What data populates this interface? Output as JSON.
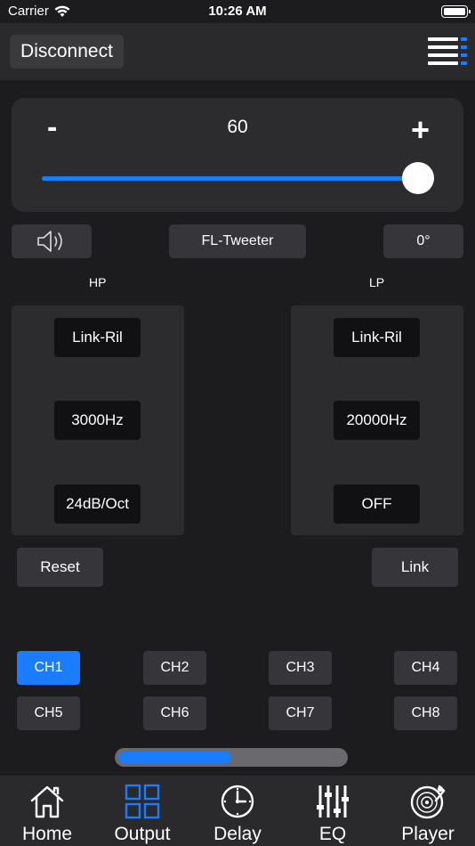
{
  "status": {
    "carrier": "Carrier",
    "time": "10:26 AM"
  },
  "nav": {
    "disconnect_label": "Disconnect"
  },
  "volume": {
    "minus": "-",
    "value": "60",
    "plus": "+",
    "level_percent": 100
  },
  "channel_info": {
    "name": "FL-Tweeter",
    "phase": "0°"
  },
  "hp": {
    "label": "HP",
    "type": "Link-Ril",
    "frequency": "3000Hz",
    "slope": "24dB/Oct"
  },
  "lp": {
    "label": "LP",
    "type": "Link-Ril",
    "frequency": "20000Hz",
    "slope": "OFF"
  },
  "actions": {
    "reset": "Reset",
    "link": "Link"
  },
  "channels": [
    "CH1",
    "CH2",
    "CH3",
    "CH4",
    "CH5",
    "CH6",
    "CH7",
    "CH8"
  ],
  "active_channel": "CH1",
  "progress": {
    "fraction": 0.5
  },
  "tabs": [
    {
      "label": "Home",
      "icon": "home-icon"
    },
    {
      "label": "Output",
      "icon": "grid-icon"
    },
    {
      "label": "Delay",
      "icon": "clock-icon"
    },
    {
      "label": "EQ",
      "icon": "equalizer-icon"
    },
    {
      "label": "Player",
      "icon": "vinyl-icon"
    }
  ],
  "active_tab": "Output",
  "colors": {
    "accent": "#1a7cff",
    "background": "#1c1c1e",
    "panel": "#2c2c2f"
  }
}
